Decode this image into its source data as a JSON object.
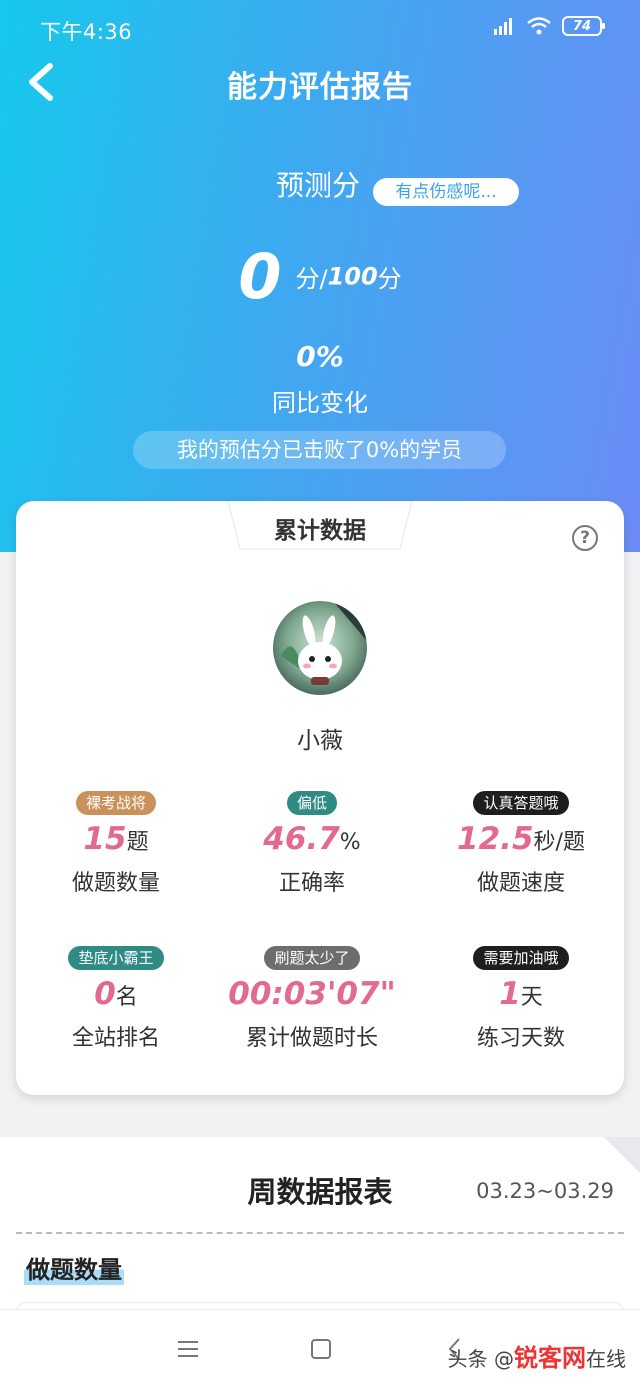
{
  "status_bar": {
    "time": "下午4:36",
    "battery": "74"
  },
  "nav": {
    "title": "能力评估报告"
  },
  "prediction": {
    "label": "预测分",
    "mood": "有点伤感呢...",
    "score": "0",
    "score_unit_prefix": "分/",
    "score_total": "100",
    "score_unit_suffix": "分",
    "change_value": "0%",
    "change_label": "同比变化",
    "beat_text": "我的预估分已击败了0%的学员"
  },
  "card": {
    "tab_title": "累计数据",
    "help": "?",
    "username": "小薇",
    "stats": [
      {
        "badge": "裸考战将",
        "badge_color": "#c9925a",
        "value": "15",
        "unit": "题",
        "label": "做题数量"
      },
      {
        "badge": "偏低",
        "badge_color": "#2f8c84",
        "value": "46.7",
        "unit": "%",
        "label": "正确率"
      },
      {
        "badge": "认真答题哦",
        "badge_color": "#1e1e1e",
        "value": "12.5",
        "unit": "秒/题",
        "label": "做题速度"
      },
      {
        "badge": "垫底小霸王",
        "badge_color": "#2f8c84",
        "value": "0",
        "unit": "名",
        "label": "全站排名"
      },
      {
        "badge": "刷题太少了",
        "badge_color": "#6d6d6d",
        "value": "00:03'07\"",
        "unit": "",
        "label": "累计做题时长"
      },
      {
        "badge": "需要加油哦",
        "badge_color": "#1e1e1e",
        "value": "1",
        "unit": "天",
        "label": "练习天数"
      }
    ]
  },
  "weekly": {
    "title": "周数据报表",
    "date_range": "03.23~03.29",
    "section_title": "做题数量"
  },
  "watermark": {
    "prefix": "头条 @",
    "brand": "锐客网",
    "suffix": "在线"
  },
  "colors": {
    "accent": "#e26a92",
    "hero_start": "#16c8ec",
    "hero_end": "#6b8cf6"
  }
}
